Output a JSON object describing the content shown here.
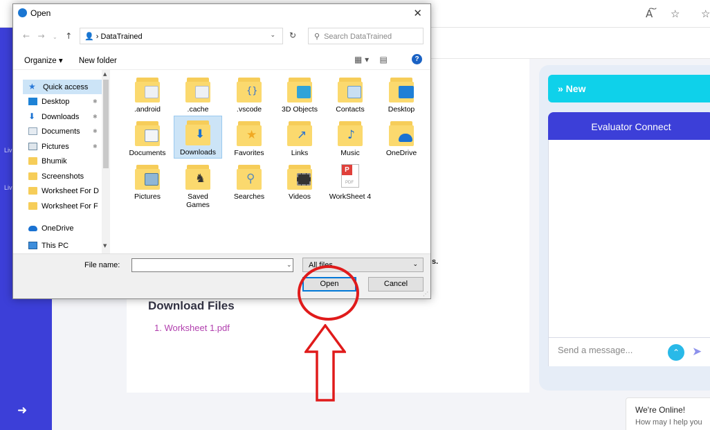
{
  "browser": {
    "read_aloud_icon": "A͠",
    "favorite_icon": "☆"
  },
  "sidebar": {
    "rail_text_1": "Liv",
    "rail_text_2": "Liv",
    "logout_icon": "logout-icon"
  },
  "page": {
    "truncated_text": "s.",
    "download_title": "Download Files",
    "download_link": "1. Worksheet 1.pdf"
  },
  "chat": {
    "new_button": "» New",
    "header": "Evaluator Connect",
    "input_placeholder": "Send a message...",
    "online_title": "We're Online!",
    "online_subtitle": "How may I help you"
  },
  "dialog": {
    "title": "Open",
    "address": "DataTrained",
    "address_prefix": "›",
    "search_placeholder": "Search DataTrained",
    "toolbar": {
      "organize": "Organize ▾",
      "new_folder": "New folder"
    },
    "tree": [
      {
        "label": "Quick access",
        "icon": "star",
        "pinned": false,
        "selected": true
      },
      {
        "label": "Desktop",
        "icon": "blue",
        "pinned": true,
        "selected": false
      },
      {
        "label": "Downloads",
        "icon": "dl",
        "pinned": true,
        "selected": false
      },
      {
        "label": "Documents",
        "icon": "doc",
        "pinned": true,
        "selected": false
      },
      {
        "label": "Pictures",
        "icon": "pic",
        "pinned": true,
        "selected": false
      },
      {
        "label": "Bhumik",
        "icon": "folder",
        "pinned": false,
        "selected": false
      },
      {
        "label": "Screenshots",
        "icon": "folder",
        "pinned": false,
        "selected": false
      },
      {
        "label": "Worksheet For D",
        "icon": "folder",
        "pinned": false,
        "selected": false
      },
      {
        "label": "Worksheet For F",
        "icon": "folder",
        "pinned": false,
        "selected": false
      },
      {
        "label": "OneDrive",
        "icon": "cloud",
        "pinned": false,
        "selected": false
      },
      {
        "label": "This PC",
        "icon": "pc",
        "pinned": false,
        "selected": false
      }
    ],
    "files": [
      {
        "label": ".android",
        "badge": "doc"
      },
      {
        "label": ".cache",
        "badge": "doc"
      },
      {
        "label": ".vscode",
        "badge": "code"
      },
      {
        "label": "3D Objects",
        "badge": "cube"
      },
      {
        "label": "Contacts",
        "badge": "contacts"
      },
      {
        "label": "Desktop",
        "badge": "desktop"
      },
      {
        "label": "Documents",
        "badge": "doc"
      },
      {
        "label": "Downloads",
        "badge": "download"
      },
      {
        "label": "Favorites",
        "badge": "star"
      },
      {
        "label": "Links",
        "badge": "link"
      },
      {
        "label": "Music",
        "badge": "music"
      },
      {
        "label": "OneDrive",
        "badge": "cloud"
      },
      {
        "label": "Pictures",
        "badge": "picture"
      },
      {
        "label": "Saved Games",
        "badge": "chess"
      },
      {
        "label": "Searches",
        "badge": "search"
      },
      {
        "label": "Videos",
        "badge": "film"
      },
      {
        "label": "WorkSheet 4",
        "badge": "pdf"
      }
    ],
    "file_name_label": "File name:",
    "file_name_value": "",
    "file_type": "All files",
    "open_button": "Open",
    "cancel_button": "Cancel"
  },
  "colors": {
    "rail": "#3c3fd8",
    "accent_cyan": "#0fd1ea",
    "link_purple": "#b13fae",
    "annotation_red": "#e01b1b",
    "win_blue": "#0078d7"
  }
}
